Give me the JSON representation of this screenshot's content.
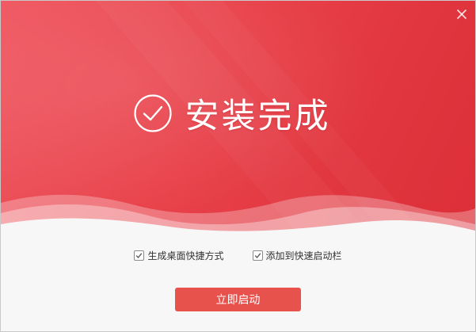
{
  "header": {
    "close_icon": "close-icon"
  },
  "hero": {
    "check_icon": "check-circle-icon",
    "title": "安装完成"
  },
  "options": [
    {
      "label": "生成桌面快捷方式",
      "checked": true
    },
    {
      "label": "添加到快速启动栏",
      "checked": true
    }
  ],
  "actions": {
    "launch_label": "立即启动"
  },
  "colors": {
    "banner_start": "#ef5760",
    "banner_end": "#dc2f38",
    "button": "#e8524d",
    "background": "#f7f7f7"
  }
}
